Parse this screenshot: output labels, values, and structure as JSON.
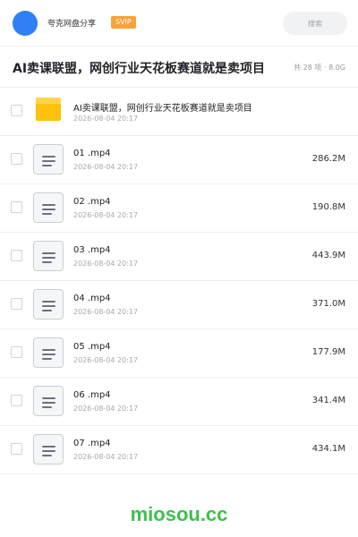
{
  "header": {
    "share_name": "夸克网盘分享",
    "badge": "SVIP",
    "search_placeholder": "搜索"
  },
  "title_row": {
    "title": "AI卖课联盟，网创行业天花板赛道就是卖项目",
    "summary": "共 28 项 · 8.0G"
  },
  "files": [
    {
      "type": "folder",
      "icon": "folder-icon",
      "name": "AI卖课联盟，网创行业天花板赛道就是卖项目",
      "date": "2026-08-04 20:17",
      "size": ""
    },
    {
      "type": "file",
      "icon": "document-icon",
      "name": "01 .mp4",
      "date": "2026-08-04 20:17",
      "size": "286.2M"
    },
    {
      "type": "file",
      "icon": "document-icon",
      "name": "02 .mp4",
      "date": "2026-08-04 20:17",
      "size": "190.8M"
    },
    {
      "type": "file",
      "icon": "document-icon",
      "name": "03 .mp4",
      "date": "2026-08-04 20:17",
      "size": "443.9M"
    },
    {
      "type": "file",
      "icon": "document-icon",
      "name": "04 .mp4",
      "date": "2026-08-04 20:17",
      "size": "371.0M"
    },
    {
      "type": "file",
      "icon": "document-icon",
      "name": "05 .mp4",
      "date": "2026-08-04 20:17",
      "size": "177.9M"
    },
    {
      "type": "file",
      "icon": "document-icon",
      "name": "06 .mp4",
      "date": "2026-08-04 20:17",
      "size": "341.4M"
    },
    {
      "type": "file",
      "icon": "document-icon",
      "name": "07 .mp4",
      "date": "2026-08-04 20:17",
      "size": "434.1M"
    }
  ],
  "watermark": "miosou.cc",
  "colors": {
    "avatar": "#2f7ff5",
    "badge": "#f7a23a",
    "folder": "#ffc20e",
    "watermark": "#3ec04f"
  }
}
